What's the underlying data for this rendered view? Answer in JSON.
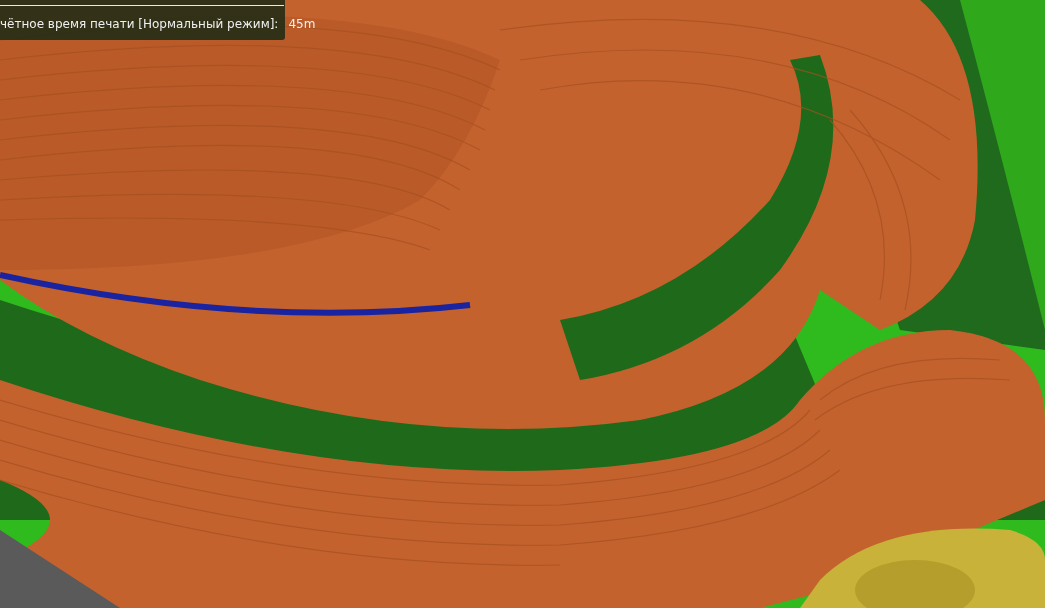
{
  "estimate_panel": {
    "label": "чётное время печати [Нормальный режим]:",
    "value": "45m"
  }
}
